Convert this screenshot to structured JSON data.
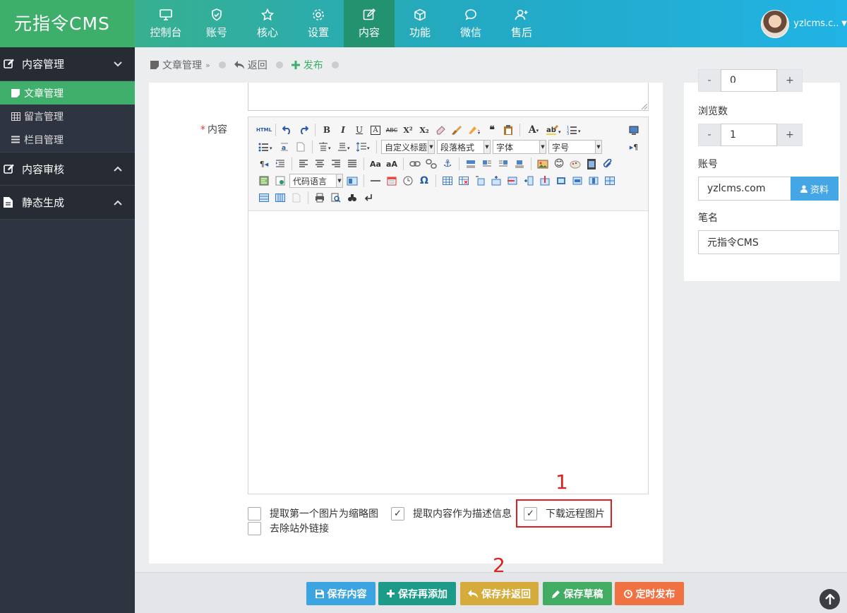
{
  "app": {
    "logo": "元指令CMS"
  },
  "nav": [
    {
      "label": "控制台",
      "icon": "monitor-icon"
    },
    {
      "label": "账号",
      "icon": "shield-icon"
    },
    {
      "label": "核心",
      "icon": "star-icon"
    },
    {
      "label": "设置",
      "icon": "gear-icon"
    },
    {
      "label": "内容",
      "icon": "edit-icon",
      "active": true
    },
    {
      "label": "功能",
      "icon": "cube-icon"
    },
    {
      "label": "微信",
      "icon": "chat-icon"
    },
    {
      "label": "售后",
      "icon": "user-plus-icon"
    }
  ],
  "user": {
    "name": "yzlcms.c..."
  },
  "sidebar": {
    "groups": [
      {
        "label": "内容管理",
        "icon": "edit-icon",
        "expanded": true,
        "items": [
          {
            "label": "文章管理",
            "icon": "file-icon",
            "active": true
          },
          {
            "label": "留言管理",
            "icon": "table-icon"
          },
          {
            "label": "栏目管理",
            "icon": "list-icon"
          }
        ]
      },
      {
        "label": "内容审核",
        "icon": "edit-icon",
        "expanded": false
      },
      {
        "label": "静态生成",
        "icon": "file-icon",
        "expanded": false
      }
    ]
  },
  "breadcrumb": {
    "article": "文章管理",
    "back": "返回",
    "publish": "发布"
  },
  "form": {
    "content_label": "内容",
    "required_mark": "*"
  },
  "editor": {
    "html_btn": "HTML",
    "custom_title": "自定义标题",
    "paragraph_format": "段落格式",
    "font": "字体",
    "font_size": "字号",
    "code_lang": "代码语言"
  },
  "options": {
    "thumb_first_image": {
      "label": "提取第一个图片为缩略图",
      "checked": false
    },
    "extract_desc": {
      "label": "提取内容作为描述信息",
      "checked": true
    },
    "download_remote": {
      "label": "下载远程图片",
      "checked": true
    },
    "remove_external_links": {
      "label": "去除站外链接",
      "checked": false
    }
  },
  "annotations": {
    "one": "1",
    "two": "2"
  },
  "right": {
    "top_stepper": {
      "value": "0",
      "minus": "-",
      "plus": "+"
    },
    "views": {
      "label": "浏览数",
      "value": "1",
      "minus": "-",
      "plus": "+"
    },
    "account": {
      "label": "账号",
      "value": "yzlcms.com",
      "button": "资料"
    },
    "penname": {
      "label": "笔名",
      "value": "元指令CMS"
    }
  },
  "footer": {
    "buttons": [
      {
        "label": "保存内容",
        "icon": "save-icon",
        "color": "#3ca4e0"
      },
      {
        "label": "保存再添加",
        "icon": "plus-icon",
        "color": "#1d9b89"
      },
      {
        "label": "保存并返回",
        "icon": "reply-icon",
        "color": "#d5ab3b"
      },
      {
        "label": "保存草稿",
        "icon": "pencil-icon",
        "color": "#41ac62"
      },
      {
        "label": "定时发布",
        "icon": "clock-icon",
        "color": "#f07142"
      }
    ]
  },
  "colors": {
    "brand_green": "#3daf6b",
    "topbar_blue": "#21b3e5",
    "annotation_red": "#e02020"
  }
}
